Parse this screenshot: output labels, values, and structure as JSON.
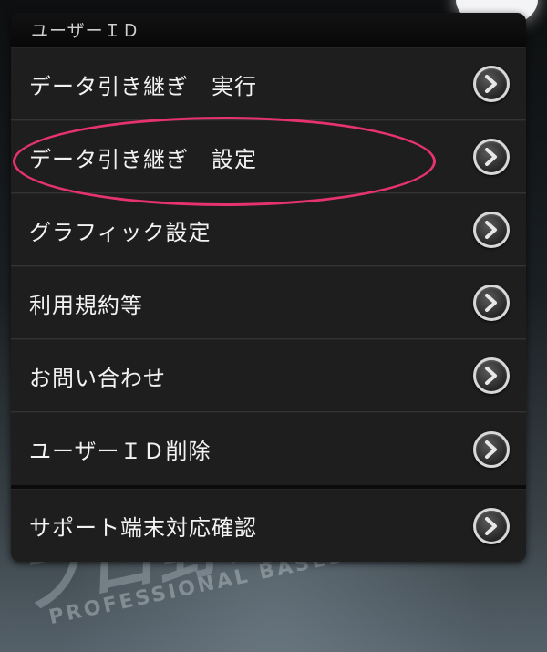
{
  "background": {
    "logo_main": "プロ野球",
    "logo_sub": "PROFESSIONAL BASEBALL"
  },
  "panel": {
    "header": "ユーザーＩＤ",
    "items": [
      {
        "label": "データ引き継ぎ　実行",
        "icon": "chevron-right-icon"
      },
      {
        "label": "データ引き継ぎ　設定",
        "icon": "chevron-right-icon"
      },
      {
        "label": "グラフィック設定",
        "icon": "chevron-right-icon"
      },
      {
        "label": "利用規約等",
        "icon": "chevron-right-icon"
      },
      {
        "label": "お問い合わせ",
        "icon": "chevron-right-icon"
      },
      {
        "label": "ユーザーＩＤ削除",
        "icon": "chevron-right-icon"
      }
    ],
    "support_item": {
      "label": "サポート端末対応確認",
      "icon": "chevron-right-icon"
    }
  },
  "colors": {
    "highlight": "#e6336e",
    "panel_bg": "#1b1b1b"
  }
}
